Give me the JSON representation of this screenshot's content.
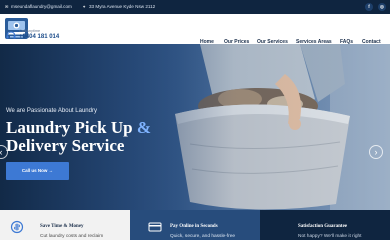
{
  "topbar": {
    "email": "mseundaflaundry@gmail.com",
    "address": "33 Myra Avenue Kyde Nsw 2112",
    "social": [
      {
        "name": "facebook-icon",
        "glyph": "f"
      },
      {
        "name": "instagram-icon",
        "glyph": "◎"
      }
    ]
  },
  "navbar": {
    "call_label": "Call Anytime",
    "phone": "+0404 181 014",
    "items": [
      "Home",
      "Our Prices",
      "Our Services",
      "Services Areas",
      "FAQs",
      "Contact"
    ]
  },
  "hero": {
    "tagline": "We are Passionate About Laundry",
    "title_line1": "Laundry Pick Up",
    "title_amp": "&",
    "title_line2": "Delivery Service",
    "cta": "Call us Now  →",
    "prev": "‹",
    "next": "›"
  },
  "features": [
    {
      "title": "Save Time & Money",
      "text": "Cut laundry costs and reclaim",
      "bg": "#f2f2f2",
      "title_color": "#1a2e4a",
      "text_color": "#4a4a4a"
    },
    {
      "title": "Pay Online in Seconds",
      "text": "Quick, secure, and hassle-free",
      "bg": "#274c7c",
      "title_color": "#ffffff",
      "text_color": "#d8e3f1"
    },
    {
      "title": "Satisfaction Guarantee",
      "text": "Not happy? We'll make it right",
      "bg": "#0f2540",
      "title_color": "#ffffff",
      "text_color": "#c9d4e3"
    }
  ]
}
